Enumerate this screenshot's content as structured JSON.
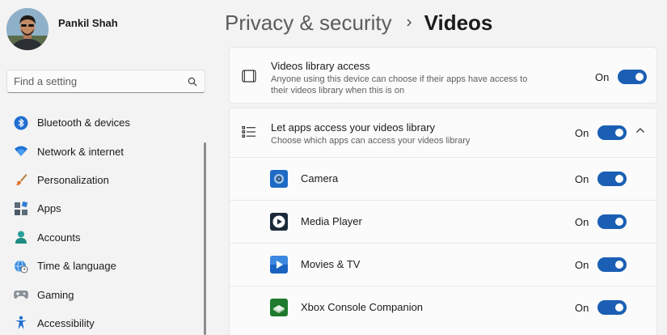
{
  "profile": {
    "name": "Pankil Shah"
  },
  "search": {
    "placeholder": "Find a setting",
    "icon": "search-icon"
  },
  "nav": {
    "items": [
      {
        "label": "Bluetooth & devices",
        "icon": "bluetooth-icon"
      },
      {
        "label": "Network & internet",
        "icon": "wifi-icon"
      },
      {
        "label": "Personalization",
        "icon": "brush-icon"
      },
      {
        "label": "Apps",
        "icon": "apps-icon"
      },
      {
        "label": "Accounts",
        "icon": "account-icon"
      },
      {
        "label": "Time & language",
        "icon": "globe-clock-icon"
      },
      {
        "label": "Gaming",
        "icon": "gamepad-icon"
      },
      {
        "label": "Accessibility",
        "icon": "accessibility-icon"
      }
    ]
  },
  "breadcrumb": {
    "parent": "Privacy & security",
    "current": "Videos"
  },
  "videos_access": {
    "title": "Videos library access",
    "description_line1": "Anyone using this device can choose if their apps have access to",
    "description_line2": "their videos library when this is on",
    "state": "On",
    "enabled": true
  },
  "apps_access": {
    "title": "Let apps access your videos library",
    "description": "Choose which apps can access your videos library",
    "state": "On",
    "enabled": true,
    "expanded": true,
    "apps": [
      {
        "name": "Camera",
        "state": "On",
        "enabled": true,
        "icon": "camera-app-icon"
      },
      {
        "name": "Media Player",
        "state": "On",
        "enabled": true,
        "icon": "media-player-app-icon"
      },
      {
        "name": "Movies & TV",
        "state": "On",
        "enabled": true,
        "icon": "movies-tv-app-icon"
      },
      {
        "name": "Xbox Console Companion",
        "state": "On",
        "enabled": true,
        "icon": "xbox-app-icon"
      }
    ]
  },
  "colors": {
    "accent": "#1a5fb4",
    "background": "#f3f3f3",
    "card": "#fbfbfb"
  }
}
